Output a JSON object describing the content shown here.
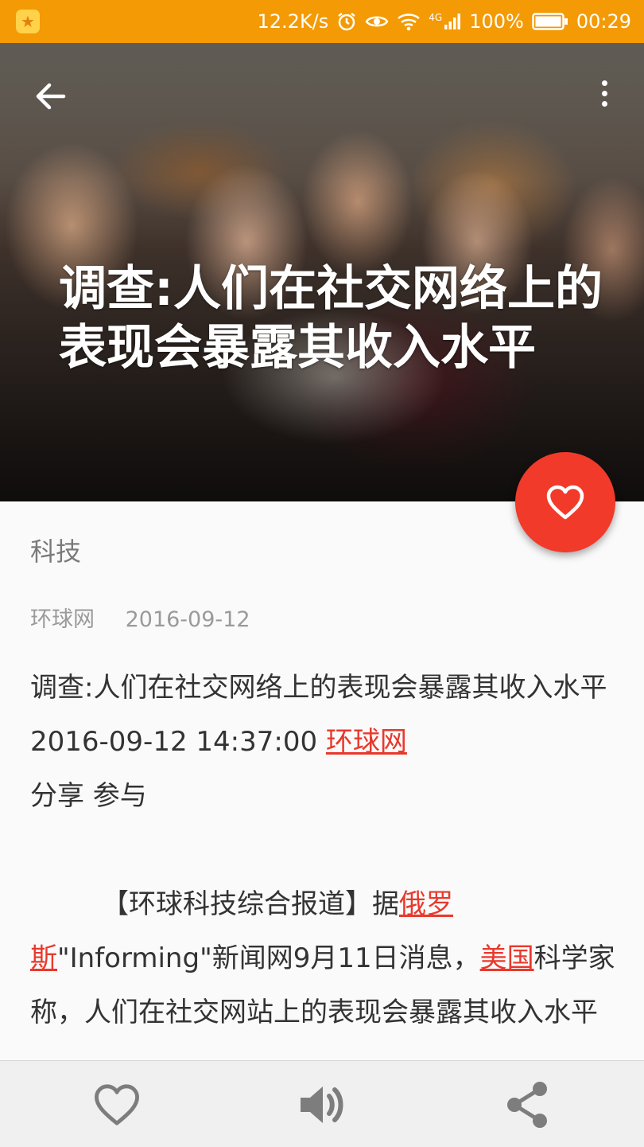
{
  "status_bar": {
    "net_speed": "12.2K/s",
    "network": "4G",
    "battery": "100%",
    "time": "00:29"
  },
  "article": {
    "title": "调查:人们在社交网络上的表现会暴露其收入水平",
    "category": "科技",
    "source": "环球网",
    "date": "2016-09-12",
    "intro_text": "调查:人们在社交网络上的表现会暴露其收入水平 2016-09-12 14:37:00 ",
    "intro_link": "环球网",
    "intro_tail": "分享 参与",
    "p2_part1": "【环球科技综合报道】据",
    "p2_link1": "俄罗斯",
    "p2_part2": "\"Informing\"新闻网9月11日消息，",
    "p2_link2": "美国",
    "p2_part3": "科学家称，人们在社交网站上的表现会暴露其收入水平"
  },
  "colors": {
    "status_bar": "#f39a05",
    "accent": "#f23a2a",
    "link": "#e8392c"
  },
  "icons": {
    "back": "arrow-left-icon",
    "more": "more-vert-icon",
    "fab": "heart-outline-icon",
    "bottom_favorite": "heart-outline-icon",
    "bottom_audio": "volume-icon",
    "bottom_share": "share-icon"
  }
}
